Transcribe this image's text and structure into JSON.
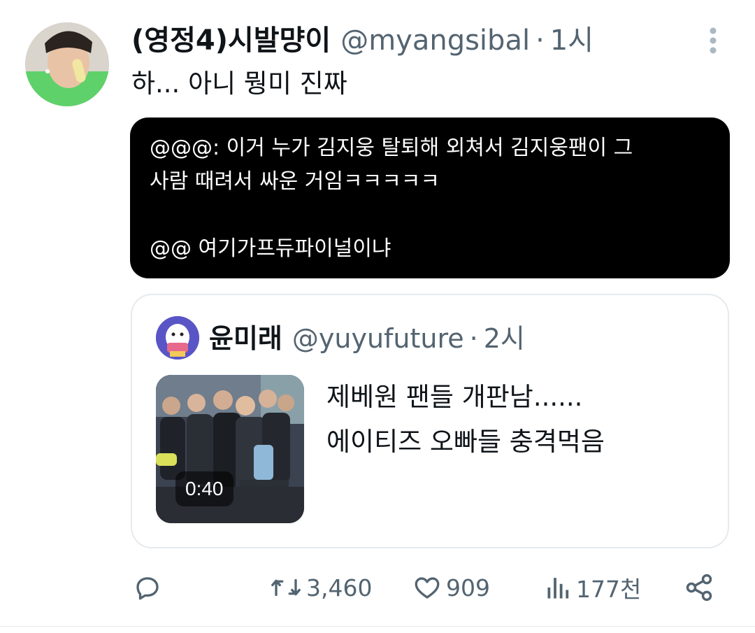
{
  "tweet": {
    "author": {
      "display_name": "(영정4)시발먕이",
      "handle": "@myangsibal",
      "separator": "·",
      "time": "1시"
    },
    "text": "하... 아니 뭥미 진짜",
    "quoted_image_text": {
      "line1": "@@@: 이거 누가 김지웅 탈퇴해 외쳐서 김지웅팬이 그",
      "line2": "사람 때려서 싸운 거임ㅋㅋㅋㅋㅋ",
      "line3": "@@ 여기가프듀파이널이냐"
    },
    "quote": {
      "author": {
        "display_name": "윤미래",
        "handle": "@yuyufuture",
        "separator": "·",
        "time": "2시"
      },
      "video_duration": "0:40",
      "text_line1": "제베원 팬들 개판남......",
      "text_line2": "에이티즈 오빠들 충격먹음"
    },
    "actions": {
      "reply_icon": "reply-icon",
      "retweet_icon": "retweet-icon",
      "retweet_count": "3,460",
      "like_icon": "heart-icon",
      "like_count": "909",
      "views_icon": "bar-chart-icon",
      "views_count": "177천",
      "share_icon": "share-icon"
    },
    "colors": {
      "text_primary": "#0f1419",
      "text_secondary": "#536471",
      "border": "#e6eaed",
      "black_box": "#000000"
    }
  }
}
